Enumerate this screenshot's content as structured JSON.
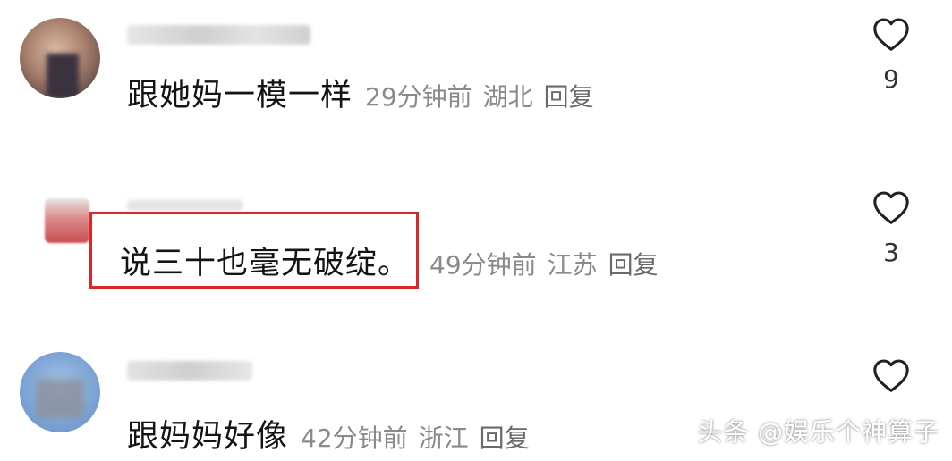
{
  "comments": [
    {
      "text": "跟她妈一模一样",
      "time": "29分钟前",
      "location": "湖北",
      "reply_label": "回复",
      "likes": "9"
    },
    {
      "text": "说三十也毫无破绽。",
      "time": "49分钟前",
      "location": "江苏",
      "reply_label": "回复",
      "likes": "3"
    },
    {
      "text": "跟妈妈好像",
      "time": "42分钟前",
      "location": "浙江",
      "reply_label": "回复",
      "likes": ""
    }
  ],
  "watermark": "头条 @娱乐个神算子",
  "colors": {
    "highlight_border": "#d8282c",
    "meta_text": "#8a8a8a"
  },
  "icons": {
    "like": "heart-outline-icon"
  }
}
